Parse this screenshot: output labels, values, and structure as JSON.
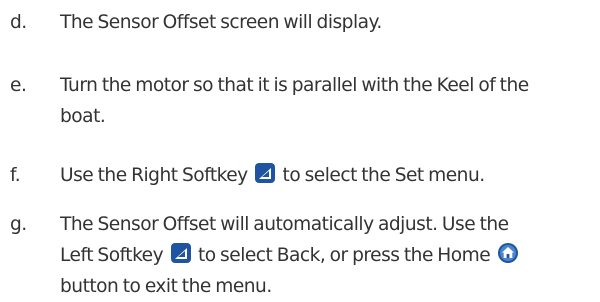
{
  "steps": [
    {
      "letter": "d.",
      "lines": [
        "The Sensor Offset screen will display."
      ]
    },
    {
      "letter": "e.",
      "lines": [
        "Turn the motor so that it is parallel with the Keel of the",
        "boat."
      ]
    },
    {
      "letter": "f.",
      "part1": "Use the Right Softkey",
      "part2": "to select the Set menu."
    },
    {
      "letter": "g.",
      "line1": "The Sensor Offset will automatically adjust.  Use the",
      "line2a": "Left Softkey",
      "line2b": "to select Back, or press the Home",
      "line3": "button to exit the menu."
    }
  ],
  "icons": {
    "right_softkey": "right-softkey-icon",
    "left_softkey": "left-softkey-icon",
    "home": "home-icon"
  },
  "colors": {
    "text": "#333333",
    "icon_fill": "#1f55a0",
    "icon_fill_light": "#4a86cf"
  }
}
